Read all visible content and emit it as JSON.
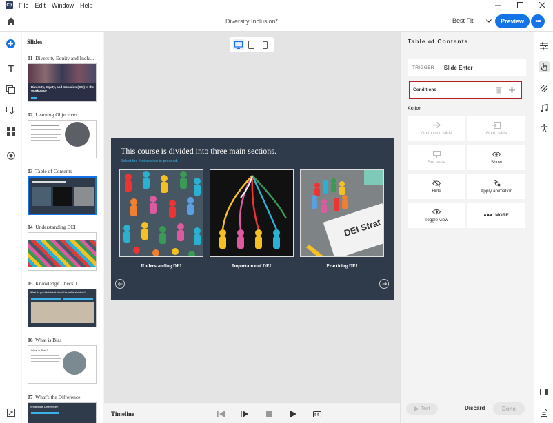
{
  "app": {
    "logo_text": "Cp"
  },
  "menu": [
    "File",
    "Edit",
    "Window",
    "Help"
  ],
  "toolbar": {
    "doc_title": "Diversity Inclusion*",
    "zoom": "Best Fit",
    "preview_label": "Preview",
    "more_label": "•••"
  },
  "slides_panel": {
    "title": "Slides",
    "slides": [
      {
        "num": "01",
        "title": "Diversity Equity and Inclu...",
        "thumb_text": "Diversity, Equity, and Inclusion (DEI) in the Workplace"
      },
      {
        "num": "02",
        "title": "Learning Objectives"
      },
      {
        "num": "03",
        "title": "Table of Contents"
      },
      {
        "num": "04",
        "title": "Understanding DEI"
      },
      {
        "num": "05",
        "title": "Knowledge Check 1",
        "thumb_text": "What do you think bleak should be in this situation?"
      },
      {
        "num": "06",
        "title": "What is Bias",
        "thumb_text": "What is Bias?"
      },
      {
        "num": "07",
        "title": "What's the Difference",
        "thumb_text": "What's the Difference?"
      }
    ]
  },
  "slide": {
    "heading": "This course is divided into three main sections.",
    "subheading": "Select the first section to proceed.",
    "cards": [
      {
        "label": "Understanding DEI"
      },
      {
        "label": "Importance of DEI"
      },
      {
        "label": "Practicing DEI",
        "sign_text": "DEI Strat"
      }
    ]
  },
  "timeline": {
    "label": "Timeline"
  },
  "interactions": {
    "title": "Table of Contents",
    "trigger_label": "TRIGGER",
    "trigger_value": "Slide Enter",
    "conditions_label": "Conditions",
    "action_label": "Action",
    "actions": [
      {
        "label": "Go to next slide",
        "icon": "arrow-right-icon",
        "enabled": false
      },
      {
        "label": "Go to slide",
        "icon": "slide-jump-icon",
        "enabled": false
      },
      {
        "label": "Set state",
        "icon": "set-state-icon",
        "enabled": false
      },
      {
        "label": "Show",
        "icon": "eye-icon",
        "enabled": true
      },
      {
        "label": "Hide",
        "icon": "eye-slash-icon",
        "enabled": true
      },
      {
        "label": "Apply animation",
        "icon": "animation-icon",
        "enabled": true
      },
      {
        "label": "Toggle view",
        "icon": "toggle-view-icon",
        "enabled": true
      },
      {
        "label": "MORE",
        "icon": "more-dots-icon",
        "enabled": true
      }
    ],
    "test_label": "Test",
    "discard_label": "Discard",
    "done_label": "Done"
  },
  "colors": {
    "accent": "#1473e6",
    "highlight": "#b81e22",
    "slide_bg": "#2f3b4a"
  }
}
